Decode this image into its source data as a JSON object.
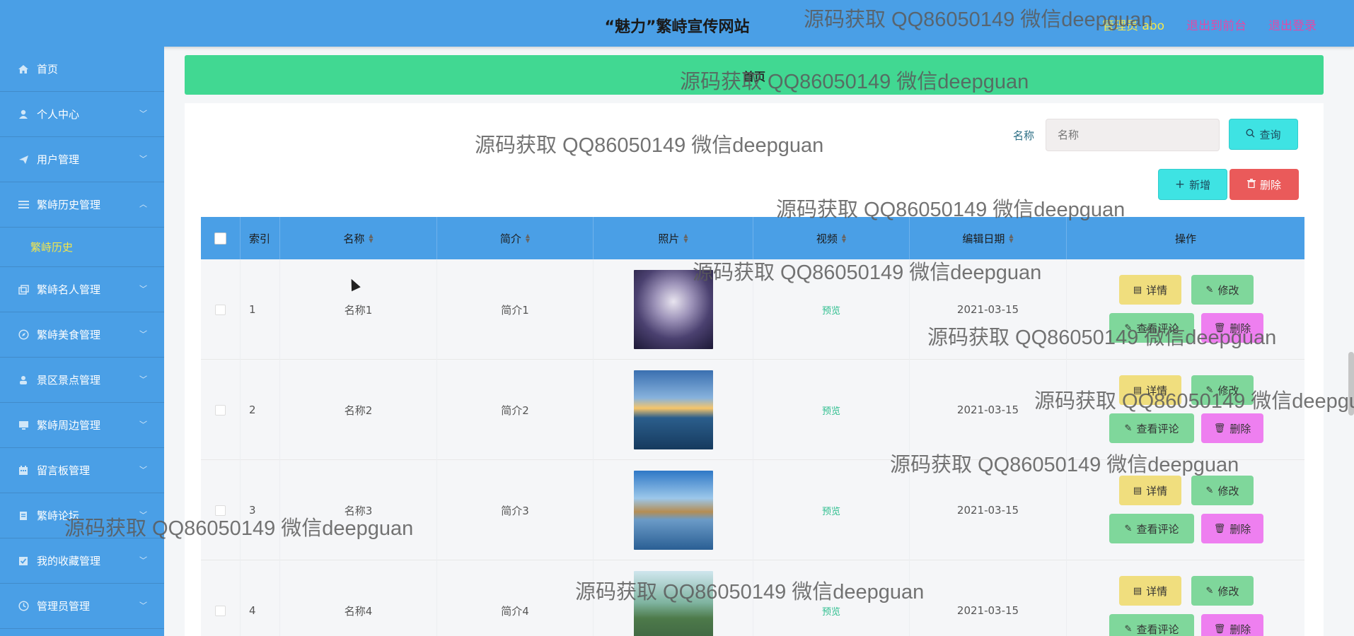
{
  "header": {
    "title": "“魅力”繁峙宣传网站",
    "user": "管理员 abo",
    "back_to_front": "退出到前台",
    "logout": "退出登录"
  },
  "sidebar": {
    "items": [
      {
        "label": "首页",
        "icon": "home-icon"
      },
      {
        "label": "个人中心",
        "icon": "user-icon"
      },
      {
        "label": "用户管理",
        "icon": "send-icon"
      },
      {
        "label": "繁峙历史管理",
        "icon": "list-icon"
      },
      {
        "label": "繁峙名人管理",
        "icon": "copy-icon"
      },
      {
        "label": "繁峙美食管理",
        "icon": "compass-icon"
      },
      {
        "label": "景区景点管理",
        "icon": "person-icon"
      },
      {
        "label": "繁峙周边管理",
        "icon": "monitor-icon"
      },
      {
        "label": "留言板管理",
        "icon": "calendar-icon"
      },
      {
        "label": "繁峙论坛",
        "icon": "book-icon"
      },
      {
        "label": "我的收藏管理",
        "icon": "check-square-icon"
      },
      {
        "label": "管理员管理",
        "icon": "clock-icon"
      }
    ],
    "active_sub": "繁峙历史"
  },
  "breadcrumb": {
    "home": "首页"
  },
  "search": {
    "label": "名称",
    "placeholder": "名称",
    "button": "查询"
  },
  "toolbar": {
    "add": "新增",
    "delete": "删除"
  },
  "table": {
    "columns": [
      "索引",
      "名称",
      "简介",
      "照片",
      "视频",
      "编辑日期",
      "操作"
    ],
    "rows": [
      {
        "index": "1",
        "name": "名称1",
        "intro": "简介1",
        "video": "预览",
        "date": "2021-03-15"
      },
      {
        "index": "2",
        "name": "名称2",
        "intro": "简介2",
        "video": "预览",
        "date": "2021-03-15"
      },
      {
        "index": "3",
        "name": "名称3",
        "intro": "简介3",
        "video": "预览",
        "date": "2021-03-15"
      },
      {
        "index": "4",
        "name": "名称4",
        "intro": "简介4",
        "video": "预览",
        "date": "2021-03-15"
      }
    ],
    "actions": {
      "detail": "详情",
      "edit": "修改",
      "review": "查看评论",
      "delete": "删除"
    }
  },
  "watermark_text": "源码获取 QQ86050149 微信deepguan",
  "colors": {
    "primary": "#4a9fe6",
    "breadcrumb": "#41d892",
    "accent_yellow": "#f5e74a"
  }
}
